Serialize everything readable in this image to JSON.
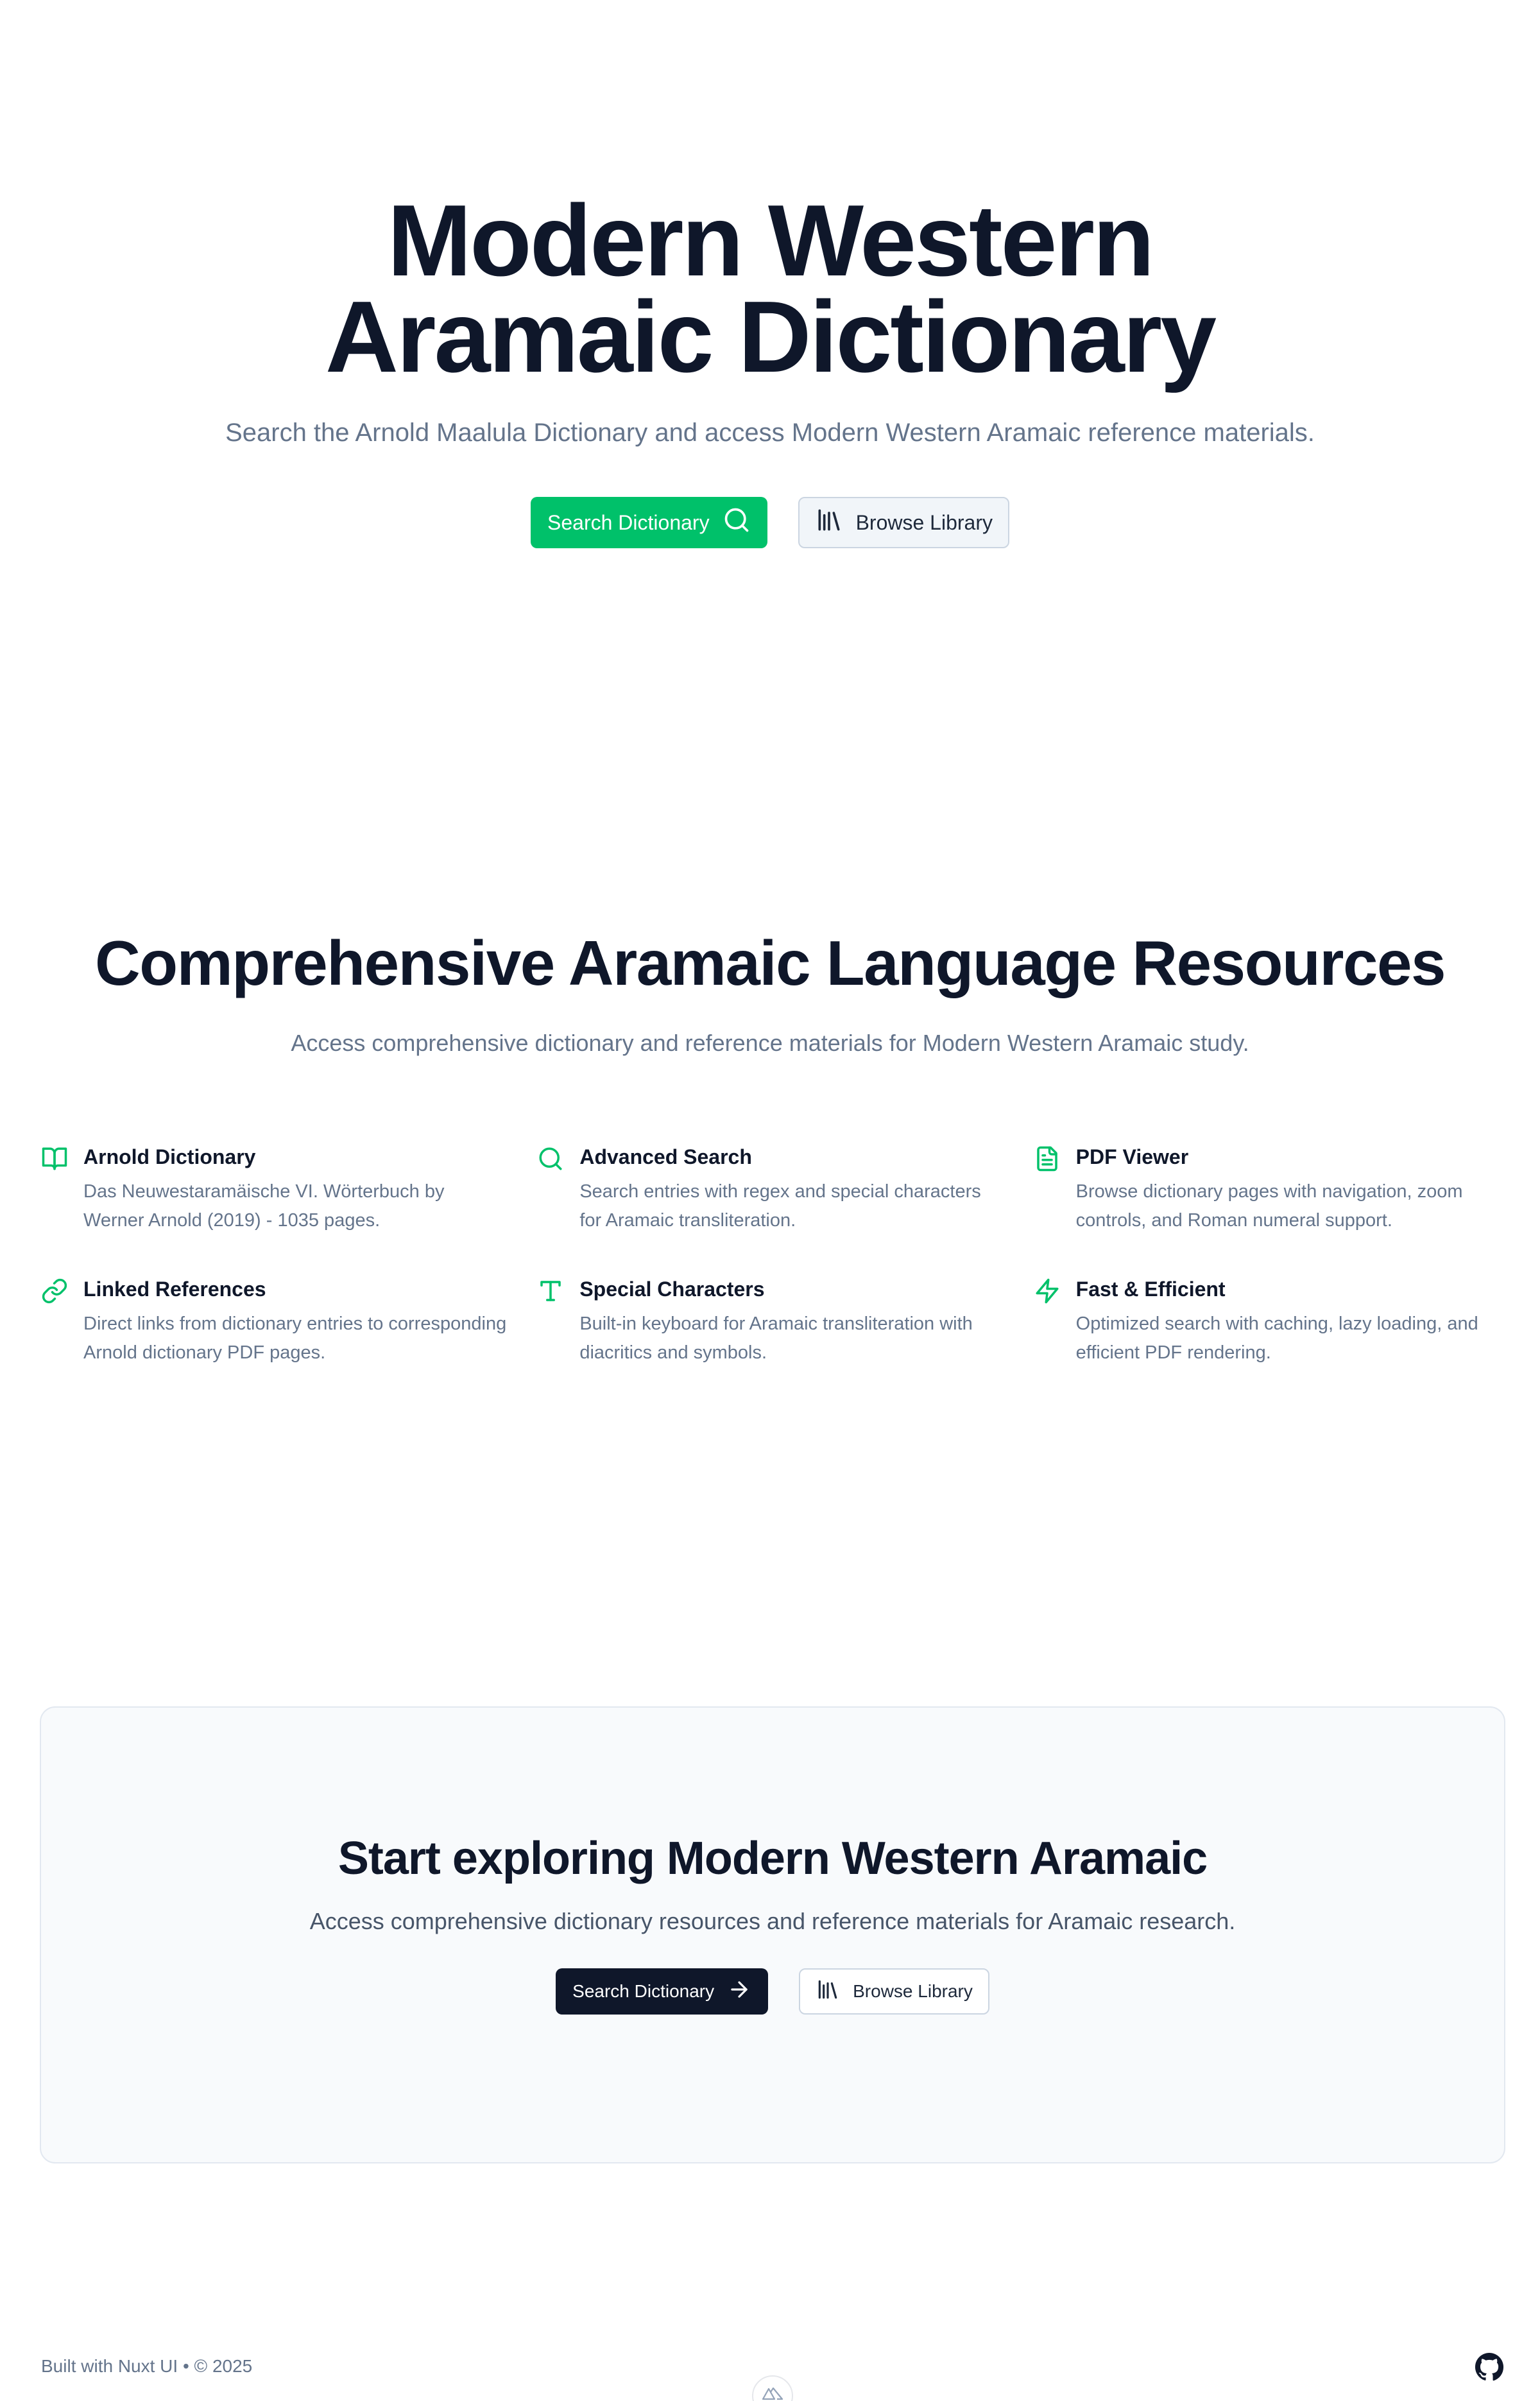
{
  "hero": {
    "title": "Modern Western Aramaic Dictionary",
    "subtitle": "Search the Arnold Maalula Dictionary and access Modern Western Aramaic reference materials.",
    "primary_label": "Search Dictionary",
    "primary_icon": "search-icon",
    "secondary_label": "Browse Library",
    "secondary_icon": "library-icon"
  },
  "features": {
    "title": "Comprehensive Aramaic Language Resources",
    "subtitle": "Access comprehensive dictionary and reference materials for Modern Western Aramaic study.",
    "items": [
      {
        "icon": "book-open-icon",
        "title": "Arnold Dictionary",
        "description": "Das Neuwestaramäische VI. Wörterbuch by Werner Arnold (2019) - 1035 pages."
      },
      {
        "icon": "search-icon",
        "title": "Advanced Search",
        "description": "Search entries with regex and special characters for Aramaic transliteration."
      },
      {
        "icon": "file-text-icon",
        "title": "PDF Viewer",
        "description": "Browse dictionary pages with navigation, zoom controls, and Roman numeral support."
      },
      {
        "icon": "link-icon",
        "title": "Linked References",
        "description": "Direct links from dictionary entries to corresponding Arnold dictionary PDF pages."
      },
      {
        "icon": "type-icon",
        "title": "Special Characters",
        "description": "Built-in keyboard for Aramaic transliteration with diacritics and symbols."
      },
      {
        "icon": "zap-icon",
        "title": "Fast & Efficient",
        "description": "Optimized search with caching, lazy loading, and efficient PDF rendering."
      }
    ]
  },
  "cta": {
    "title": "Start exploring Modern Western Aramaic",
    "subtitle": "Access comprehensive dictionary resources and reference materials for Aramaic research.",
    "primary_label": "Search Dictionary",
    "primary_icon": "arrow-right-icon",
    "secondary_label": "Browse Library",
    "secondary_icon": "library-icon"
  },
  "footer": {
    "credit": "Built with Nuxt UI • © 2025",
    "github_icon": "github-icon"
  },
  "colors": {
    "accent": "#00c16a",
    "heading": "#0f172a",
    "muted": "#64748b",
    "cta_background": "#f8fafc"
  }
}
